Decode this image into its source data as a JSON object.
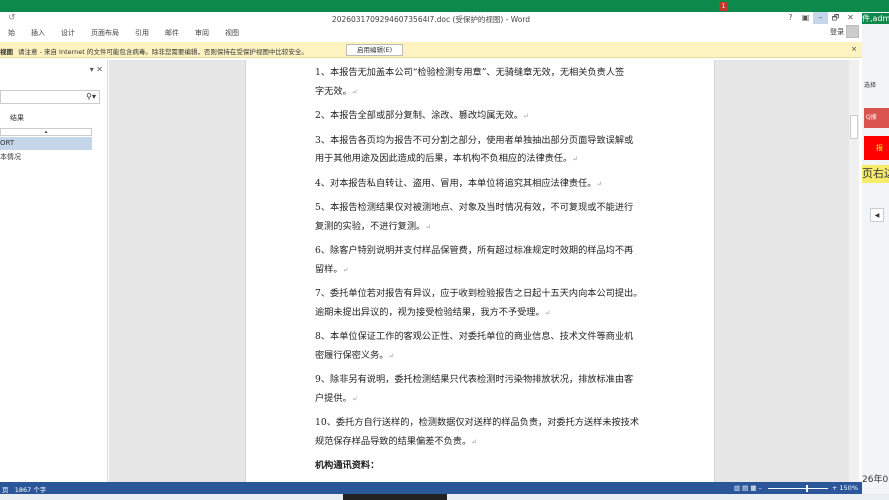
{
  "window": {
    "title": "20260317092946073564l7.doc (受保护的视图) - Word",
    "help": "?",
    "min": "–",
    "restore": "🗗",
    "close": "✕",
    "login": "登录",
    "notification_count": "1"
  },
  "ribbon": {
    "tabs": [
      "始",
      "插入",
      "设计",
      "页面布局",
      "引用",
      "邮件",
      "审阅",
      "视图"
    ]
  },
  "message_bar": {
    "label": "视图",
    "text": "请注意 - 来自 Internet 的文件可能包含病毒。除非您需要编辑，否则保持在受保护视图中比较安全。",
    "button": "启用编辑(E)",
    "close": "×"
  },
  "nav_pane": {
    "results_label": "结果",
    "items": [
      "ORT",
      "本情况"
    ],
    "search_icon": "search-icon"
  },
  "document": {
    "paragraphs": [
      [
        "1、本报告无加盖本公司“检验检测专用章”、无骑缝章无效，无相关负责人签",
        "字无效。"
      ],
      [
        "2、本报告全部或部分复制、涂改、篡改均属无效。"
      ],
      [
        "3、本报告各页均为报告不可分割之部分，使用者单独抽出部分页面导致误解或",
        "用于其他用途及因此造成的后果，本机构不负相应的法律责任。"
      ],
      [
        "4、对本报告私自转让、盗用、冒用，本单位将追究其相应法律责任。"
      ],
      [
        "5、本报告检测结果仅对被测地点、对象及当时情况有效，不可复现或不能进行",
        "复测的实验，不进行复测。"
      ],
      [
        "6、除客户特别说明并支付样品保管费，所有超过标准规定时效期的样品均不再",
        "留样。"
      ],
      [
        "7、委托单位若对报告有异议，应于收到检验报告之日起十五天内向本公司提出。",
        "逾期未提出异议的，视为接受检验结果，我方不予受理。"
      ],
      [
        "8、本单位保证工作的客观公正性、对委托单位的商业信息、技术文件等商业机",
        "密履行保密义务。"
      ],
      [
        "9、除非另有说明，委托检测结果只代表检测时污染物排放状况，排放标准由客",
        "户提供。"
      ],
      [
        "10、委托方自行送样的，检测数据仅对送样的样品负责，对委托方送样未按技术",
        "规范保存样品导致的结果偏差不负责。"
      ]
    ],
    "heading": "机构通讯资料：",
    "para_mark": "↵"
  },
  "status": {
    "page": "页",
    "words": "1867 个字",
    "zoom": "150%"
  },
  "background_page": {
    "top": "件,adm",
    "select": "选择",
    "search_btn": "Q搜",
    "red_btn": "报",
    "yellow_text": "页右边",
    "date": "26年0"
  }
}
